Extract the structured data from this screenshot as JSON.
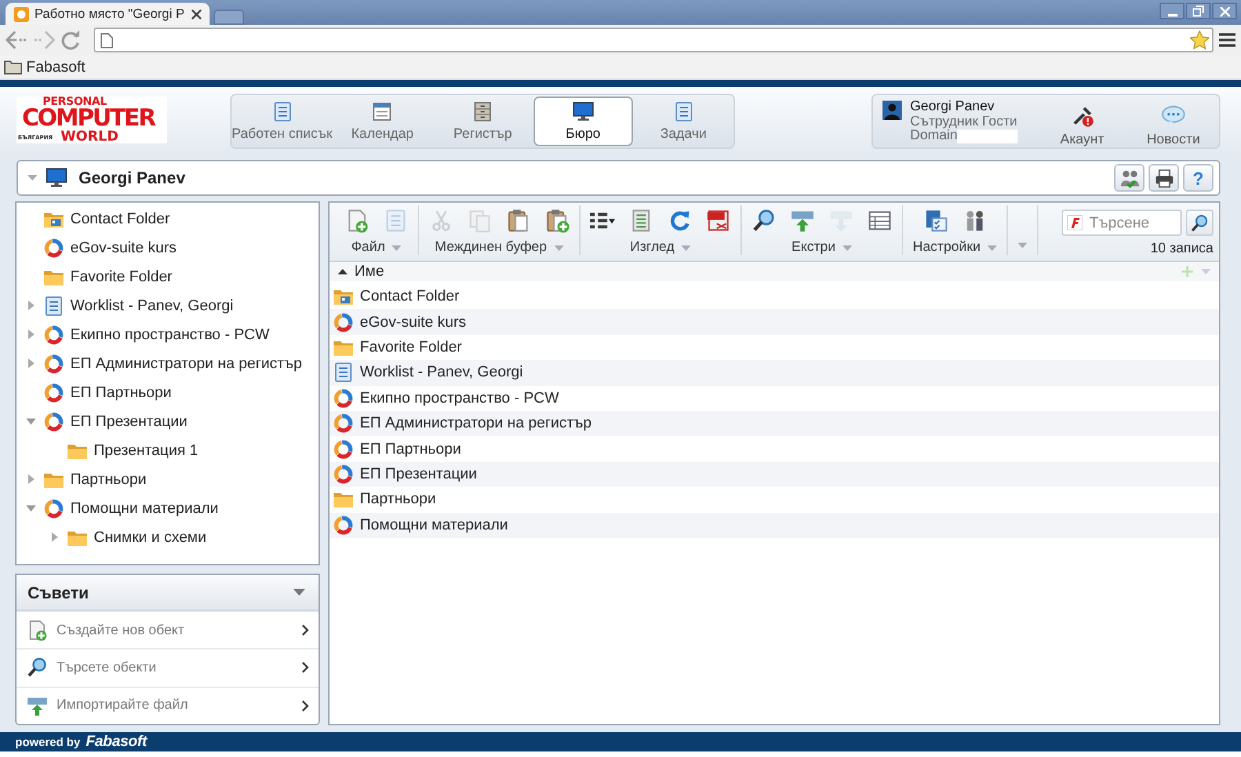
{
  "browser": {
    "tab_title": "Работно място \"Georgi P",
    "bookmarks": [
      {
        "label": "Fabasoft"
      }
    ]
  },
  "logo": {
    "top": "PERSONAL",
    "middle": "COMPUTER",
    "country": "БЪЛГАРИЯ",
    "bottom": "WORLD"
  },
  "nav_tabs": [
    {
      "kind": "worklist",
      "label": "Работен списък",
      "selected": false
    },
    {
      "kind": "calendar",
      "label": "Календар",
      "selected": false
    },
    {
      "kind": "register",
      "label": "Регистър",
      "selected": false
    },
    {
      "kind": "desk",
      "label": "Бюро",
      "selected": true
    },
    {
      "kind": "tasks",
      "label": "Задачи",
      "selected": false
    }
  ],
  "user": {
    "name": "Georgi Panev",
    "role": "Сътрудник Гости",
    "domain": "Domain"
  },
  "user_actions": [
    {
      "kind": "account",
      "label": "Акаунт"
    },
    {
      "kind": "news",
      "label": "Новости"
    }
  ],
  "breadcrumb": {
    "title": "Georgi Panev",
    "buttons": [
      {
        "kind": "group"
      },
      {
        "kind": "print"
      },
      {
        "kind": "help",
        "label": "?"
      }
    ]
  },
  "tree": [
    {
      "kind": "contact-folder",
      "label": "Contact Folder"
    },
    {
      "kind": "teamroom",
      "label": "eGov-suite kurs"
    },
    {
      "kind": "folder",
      "label": "Favorite Folder"
    },
    {
      "kind": "worklist",
      "label": "Worklist - Panev, Georgi",
      "expanded": false
    },
    {
      "kind": "teamroom",
      "label": "Екипно пространство - PCW",
      "expanded": false
    },
    {
      "kind": "teamroom",
      "label": "ЕП Администратори на регистър",
      "expanded": false
    },
    {
      "kind": "teamroom",
      "label": "ЕП Партньори"
    },
    {
      "kind": "teamroom",
      "label": "ЕП Презентации",
      "expanded": true,
      "children": [
        {
          "kind": "folder",
          "label": "Презентация 1"
        }
      ]
    },
    {
      "kind": "folder",
      "label": "Партньори",
      "expanded": false
    },
    {
      "kind": "teamroom",
      "label": "Помощни материали",
      "expanded": true,
      "children": [
        {
          "kind": "folder",
          "label": "Снимки и схеми",
          "expanded": false
        }
      ]
    }
  ],
  "tips": {
    "title": "Съвети",
    "items": [
      {
        "kind": "create",
        "label": "Създайте нов обект"
      },
      {
        "kind": "search",
        "label": "Търсете обекти"
      },
      {
        "kind": "import",
        "label": "Импортирайте файл"
      }
    ]
  },
  "toolbar": {
    "groups": [
      {
        "label": "Файл",
        "tools": [
          {
            "kind": "new",
            "disabled": false
          },
          {
            "kind": "checklist",
            "disabled": true
          }
        ]
      },
      {
        "label": "Междинен буфер",
        "tools": [
          {
            "kind": "cut",
            "disabled": true
          },
          {
            "kind": "copy",
            "disabled": true
          },
          {
            "kind": "paste",
            "disabled": false
          },
          {
            "kind": "paste-new",
            "disabled": false
          }
        ]
      },
      {
        "label": "Изглед",
        "tools": [
          {
            "kind": "list-view",
            "disabled": false
          },
          {
            "kind": "details",
            "disabled": false
          },
          {
            "kind": "refresh",
            "disabled": false
          },
          {
            "kind": "pdf",
            "disabled": false
          }
        ]
      },
      {
        "label": "Екстри",
        "tools": [
          {
            "kind": "search",
            "disabled": false
          },
          {
            "kind": "upload",
            "disabled": false
          },
          {
            "kind": "download",
            "disabled": true
          },
          {
            "kind": "table",
            "disabled": false
          }
        ]
      },
      {
        "label": "Настройки",
        "tools": [
          {
            "kind": "settings",
            "disabled": false
          },
          {
            "kind": "persons",
            "disabled": false
          }
        ]
      }
    ],
    "more_menu": {
      "expanded": false
    },
    "search": {
      "placeholder": "Търсене"
    },
    "count": "10 записа"
  },
  "list": {
    "columns": [
      {
        "label": "Име",
        "sorted_ascending": true
      }
    ],
    "rows": [
      {
        "kind": "contact-folder",
        "name": "Contact Folder"
      },
      {
        "kind": "teamroom",
        "name": "eGov-suite kurs"
      },
      {
        "kind": "folder",
        "name": "Favorite Folder"
      },
      {
        "kind": "worklist",
        "name": "Worklist - Panev, Georgi"
      },
      {
        "kind": "teamroom",
        "name": "Екипно пространство - PCW"
      },
      {
        "kind": "teamroom",
        "name": "ЕП Администратори на регистър"
      },
      {
        "kind": "teamroom",
        "name": "ЕП Партньори"
      },
      {
        "kind": "teamroom",
        "name": "ЕП Презентации"
      },
      {
        "kind": "folder",
        "name": "Партньори"
      },
      {
        "kind": "teamroom",
        "name": "Помощни материали"
      }
    ]
  },
  "footer": {
    "prefix": "powered by",
    "brand": "Fabasoft"
  }
}
